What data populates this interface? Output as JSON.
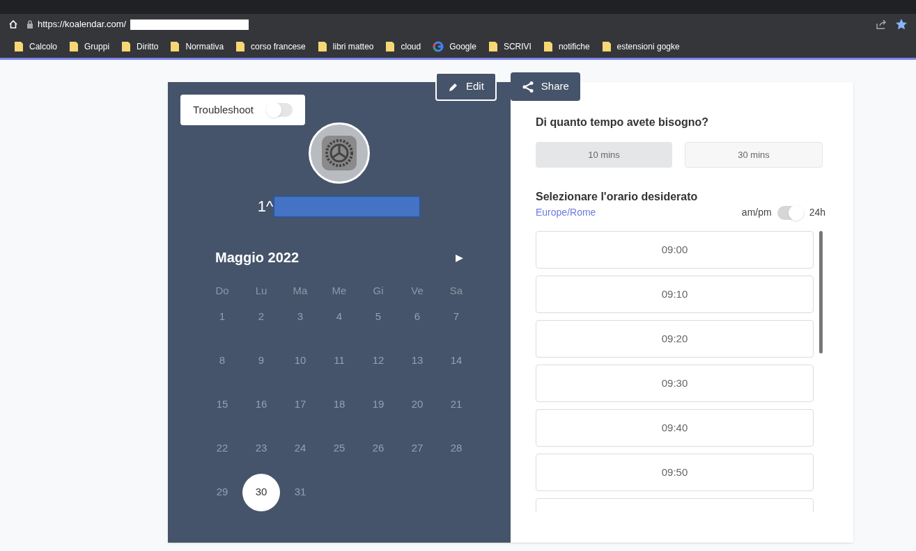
{
  "browser": {
    "url": "https://koalendar.com/",
    "bookmarks": [
      {
        "label": "Calcolo",
        "kind": "folder"
      },
      {
        "label": "Gruppi",
        "kind": "folder"
      },
      {
        "label": "Diritto",
        "kind": "folder"
      },
      {
        "label": "Normativa",
        "kind": "folder"
      },
      {
        "label": "corso francese",
        "kind": "folder"
      },
      {
        "label": "libri matteo",
        "kind": "folder"
      },
      {
        "label": "cloud",
        "kind": "folder"
      },
      {
        "label": "Google",
        "kind": "google"
      },
      {
        "label": "SCRIVI",
        "kind": "folder"
      },
      {
        "label": "notifiche",
        "kind": "folder"
      },
      {
        "label": "estensioni gogke",
        "kind": "folder"
      }
    ]
  },
  "actions": [
    {
      "label": "Edit",
      "kind": "edit"
    },
    {
      "label": "Share",
      "kind": "share"
    }
  ],
  "troubleshoot": {
    "label": "Troubleshoot",
    "on": false
  },
  "event": {
    "title_prefix": "1^"
  },
  "calendar": {
    "month": "Maggio 2022",
    "next": "▶",
    "weekdays": [
      "Do",
      "Lu",
      "Ma",
      "Me",
      "Gi",
      "Ve",
      "Sa"
    ],
    "weeks": [
      [
        {
          "label": "1",
          "disabled": true,
          "selected": false
        },
        {
          "label": "2",
          "disabled": true,
          "selected": false
        },
        {
          "label": "3",
          "disabled": true,
          "selected": false
        },
        {
          "label": "4",
          "disabled": true,
          "selected": false
        },
        {
          "label": "5",
          "disabled": true,
          "selected": false
        },
        {
          "label": "6",
          "disabled": true,
          "selected": false
        },
        {
          "label": "7",
          "disabled": true,
          "selected": false
        }
      ],
      [
        {
          "label": "8",
          "disabled": true,
          "selected": false
        },
        {
          "label": "9",
          "disabled": true,
          "selected": false
        },
        {
          "label": "10",
          "disabled": true,
          "selected": false
        },
        {
          "label": "11",
          "disabled": true,
          "selected": false
        },
        {
          "label": "12",
          "disabled": true,
          "selected": false
        },
        {
          "label": "13",
          "disabled": true,
          "selected": false
        },
        {
          "label": "14",
          "disabled": true,
          "selected": false
        }
      ],
      [
        {
          "label": "15",
          "disabled": true,
          "selected": false
        },
        {
          "label": "16",
          "disabled": true,
          "selected": false
        },
        {
          "label": "17",
          "disabled": true,
          "selected": false
        },
        {
          "label": "18",
          "disabled": true,
          "selected": false
        },
        {
          "label": "19",
          "disabled": true,
          "selected": false
        },
        {
          "label": "20",
          "disabled": true,
          "selected": false
        },
        {
          "label": "21",
          "disabled": true,
          "selected": false
        }
      ],
      [
        {
          "label": "22",
          "disabled": true,
          "selected": false
        },
        {
          "label": "23",
          "disabled": true,
          "selected": false
        },
        {
          "label": "24",
          "disabled": true,
          "selected": false
        },
        {
          "label": "25",
          "disabled": true,
          "selected": false
        },
        {
          "label": "26",
          "disabled": true,
          "selected": false
        },
        {
          "label": "27",
          "disabled": true,
          "selected": false
        },
        {
          "label": "28",
          "disabled": true,
          "selected": false
        }
      ],
      [
        {
          "label": "29",
          "disabled": true,
          "selected": false
        },
        {
          "label": "30",
          "disabled": false,
          "selected": true
        },
        {
          "label": "31",
          "disabled": true,
          "selected": false
        }
      ]
    ]
  },
  "duration": {
    "title": "Di quanto tempo avete bisogno?",
    "options": [
      {
        "label": "10 mins",
        "selected": true
      },
      {
        "label": "30 mins",
        "selected": false
      }
    ]
  },
  "times": {
    "title": "Selezionare l'orario desiderato",
    "timezone": "Europe/Rome",
    "format": {
      "left": "am/pm",
      "right": "24h",
      "on": true
    },
    "slots": [
      {
        "kind": "full",
        "label": "09:00"
      },
      {
        "kind": "full",
        "label": "09:10"
      },
      {
        "kind": "full",
        "label": "09:20"
      },
      {
        "kind": "full",
        "label": "09:30"
      },
      {
        "kind": "full",
        "label": "09:40"
      },
      {
        "kind": "full",
        "label": "09:50"
      },
      {
        "kind": "cut"
      }
    ]
  }
}
